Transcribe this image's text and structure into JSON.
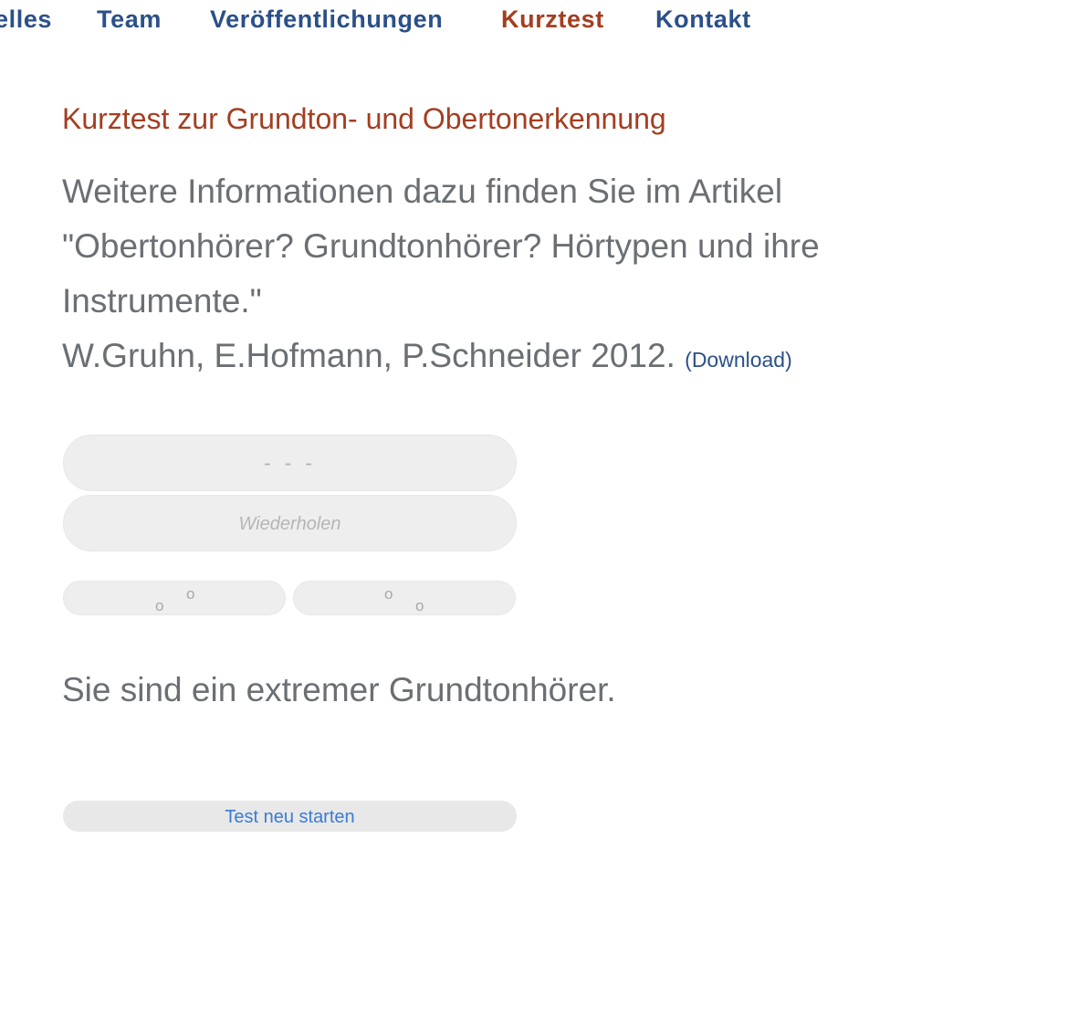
{
  "nav": {
    "items": [
      {
        "label": "elles",
        "active": false
      },
      {
        "label": "Team",
        "active": false
      },
      {
        "label": "Veröffentlichungen",
        "active": false
      },
      {
        "label": "Kurztest",
        "active": true
      },
      {
        "label": "Kontakt",
        "active": false
      }
    ]
  },
  "main": {
    "heading": "Kurztest zur Grundton- und Obertonerkennung",
    "intro_text": "Weitere Informationen dazu finden Sie im Artikel \"Obertonhörer? Grundtonhörer? Hörtypen und ihre Instrumente.\"",
    "authors": "W.Gruhn, E.Hofmann, P.Schneider 2012.",
    "download_label": "(Download)",
    "display_value": "- - -",
    "repeat_label": "Wiederholen",
    "choice_low_high": {
      "glyph_low": "o",
      "glyph_high": "o"
    },
    "choice_high_low": {
      "glyph_high": "o",
      "glyph_low": "o"
    },
    "result_text": "Sie sind ein extremer Grundtonhörer.",
    "restart_label": "Test neu starten"
  },
  "colors": {
    "nav_link": "#2b5089",
    "accent": "#a43e21",
    "body_text": "#6b6f73",
    "button_bg": "#eeeeee",
    "restart_text": "#3a7bd5"
  }
}
